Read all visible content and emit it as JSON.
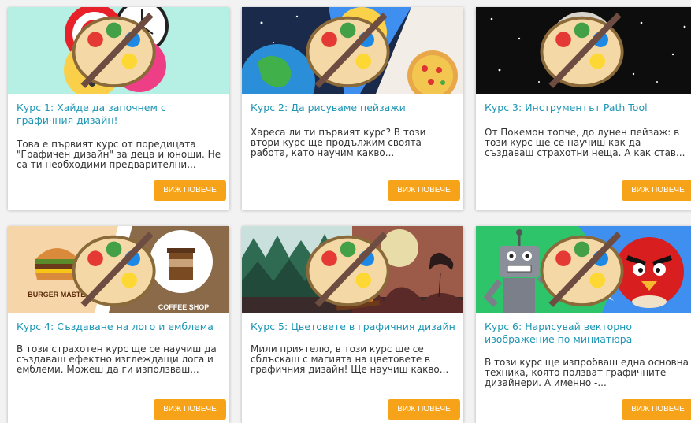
{
  "courses": [
    {
      "title": "Курс 1: Хайде да започнем с графичния дизайн!",
      "description": "Това е първият курс от поредицата \"Графичен дизайн\" за деца и юноши. Не са ти необходими предварителни...",
      "button": "ВИЖ ПОВЕЧЕ"
    },
    {
      "title": "Курс 2: Да рисуваме пейзажи",
      "description": "Хареса ли ти първият курс? В този втори курс ще продължим своята работа, като научим какво...",
      "button": "ВИЖ ПОВЕЧЕ"
    },
    {
      "title": "Курс 3: Инструментът Path Tool",
      "description": "От Покемон топче, до лунен пейзаж: в този курс ще се научиш как да създаваш страхотни неща. А как став...",
      "button": "ВИЖ ПОВЕЧЕ"
    },
    {
      "title": "Курс 4: Създаване на лого и емблема",
      "description": "В този страхотен курс ще се научиш да създаваш ефектно изглеждащи лога и емблеми. Можеш да ги използваш...",
      "button": "ВИЖ ПОВЕЧЕ",
      "image_texts": {
        "left": "BURGER MASTER",
        "right": "COFFEE SHOP"
      }
    },
    {
      "title": "Курс 5: Цветовете в графичния дизайн",
      "description": " Мили приятелю, в този курс ще се сблъскаш с магията на цветовете в графичния дизайн! Ще научиш какво...",
      "button": "ВИЖ ПОВЕЧЕ"
    },
    {
      "title": "Курс 6: Нарисувай векторно изображение по миниатюра",
      "description": "В този курс ще изпробваш една основна техника, която ползват графичните дизайнери. А именно -...",
      "button": "ВИЖ ПОВЕЧЕ"
    }
  ],
  "colors": {
    "title": "#1e96b4",
    "button": "#f7a31a",
    "background": "#f2f2f2"
  }
}
